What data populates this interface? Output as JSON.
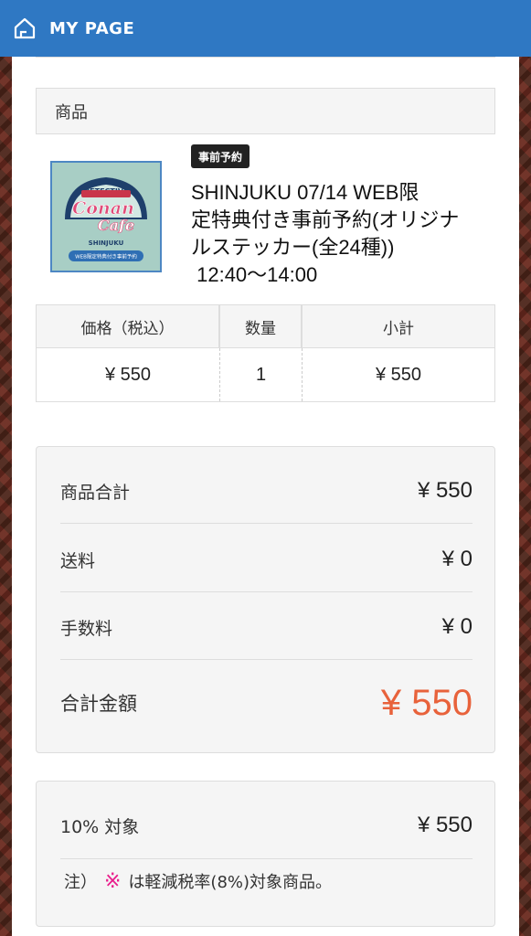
{
  "header": {
    "title": "MY PAGE",
    "icon": "home-icon"
  },
  "section": {
    "title": "商品"
  },
  "product": {
    "tag": "事前予約",
    "name_lines": [
      "SHINJUKU 07/14 WEB限",
      "定特典付き事前予約(オリジナ",
      "ルステッカー(全24種))",
      " 12:40〜14:00"
    ],
    "image": {
      "arch": "DETECTIVE",
      "line1": "Conan",
      "line2": "Cafe",
      "city": "SHINJUKU",
      "band": "WEB限定特典付き事前予約"
    }
  },
  "table": {
    "headers": [
      "価格（税込）",
      "数量",
      "小計"
    ],
    "row": {
      "price": "¥ 550",
      "qty": "1",
      "subtotal": "¥ 550"
    }
  },
  "summary": {
    "rows": [
      {
        "label": "商品合計",
        "value": "¥ 550"
      },
      {
        "label": "送料",
        "value": "¥ 0"
      },
      {
        "label": "手数料",
        "value": "¥ 0"
      }
    ],
    "total": {
      "label": "合計金額",
      "value": "¥ 550"
    }
  },
  "tax": {
    "label": "10% 対象",
    "value": "¥ 550",
    "note_prefix": "注）",
    "note_mark": "※",
    "note_text": "は軽減税率(8%)対象商品。"
  },
  "colors": {
    "header": "#2f78c3",
    "total": "#e8623b",
    "mark": "#e91e8c"
  }
}
